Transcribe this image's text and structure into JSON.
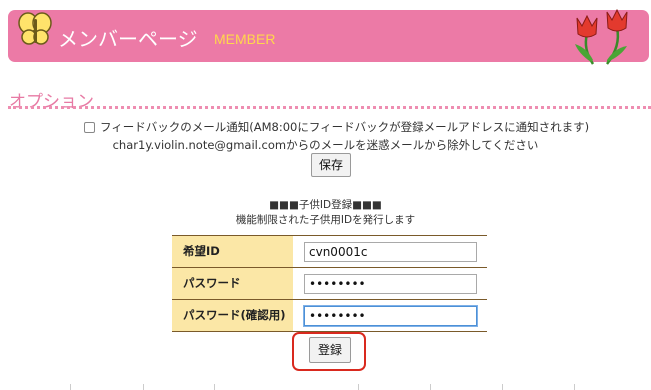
{
  "header": {
    "title": "メンバーページ",
    "subtitle": "MEMBER"
  },
  "option": {
    "heading": "オプション",
    "feedback_checkbox_checked": false,
    "feedback_label": "フィードバックのメール通知(AM8:00にフィードバックが登録メールアドレスに通知されます)",
    "email_note": "char1y.violin.note@gmail.comからのメールを迷惑メールから除外してください",
    "save_label": "保存"
  },
  "child_registration": {
    "title": "■■■子供ID登録■■■",
    "subtitle": "機能制限された子供用IDを発行します",
    "fields": [
      {
        "label": "希望ID",
        "value": "cvn0001c"
      },
      {
        "label": "パスワード",
        "value": "••••••••"
      },
      {
        "label": "パスワード(確認用)",
        "value": "••••••••"
      }
    ],
    "register_label": "登録"
  },
  "colors": {
    "header_bg": "#ec7aa6",
    "accent_yellow": "#ffd84a",
    "label_bg": "#fbe7a6",
    "highlight_red": "#d9291e"
  }
}
